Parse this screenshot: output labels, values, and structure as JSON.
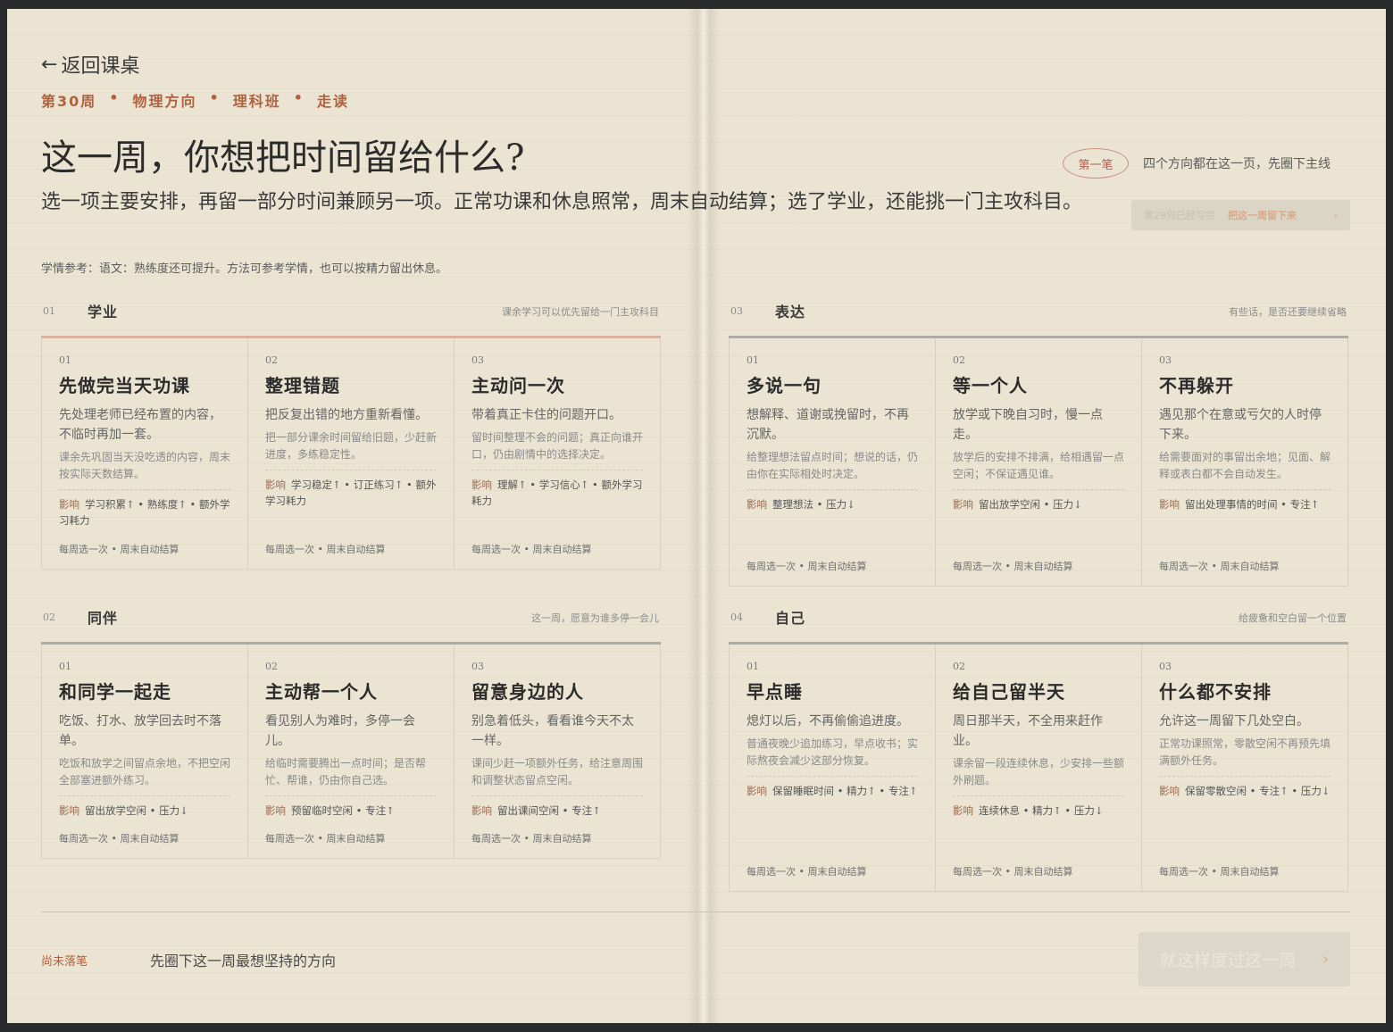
{
  "nav": {
    "back_arrow": "←",
    "back_label": "返回课桌"
  },
  "crumbs": [
    "第30周",
    "物理方向",
    "理科班",
    "走读"
  ],
  "crumb_sep": "•",
  "title": "这一周，你想把时间留给什么?",
  "subtitle": "选一项主要安排，再留一部分时间兼顾另一项。正常功课和休息照常，周末自动结算；选了学业，还能挑一门主攻科目。",
  "hint": "学情参考：语文：熟练度还可提升。方法可参考学情，也可以按精力留出休息。",
  "stamp": {
    "label": "第一笔",
    "note": "四个方向都在这一页，先圈下主线"
  },
  "save_week": {
    "done": "第29周已经写完",
    "action": "把这一周留下来",
    "arrow": "›"
  },
  "sections": [
    {
      "num": "01",
      "title": "学业",
      "note": "课余学习可以优先留给一门主攻科目",
      "cards": [
        {
          "num": "01",
          "title": "先做完当天功课",
          "desc": "先处理老师已经布置的内容，不临时再加一套。",
          "detail": "课余先巩固当天没吃透的内容，周末按实际天数结算。",
          "impact_label": "影响",
          "impact": "学习积累↑ • 熟练度↑ • 额外学习耗力",
          "foot": "每周选一次 • 周末自动结算"
        },
        {
          "num": "02",
          "title": "整理错题",
          "desc": "把反复出错的地方重新看懂。",
          "detail": "把一部分课余时间留给旧题，少赶新进度，多练稳定性。",
          "impact_label": "影响",
          "impact": "学习稳定↑ • 订正练习↑ • 额外学习耗力",
          "foot": "每周选一次 • 周末自动结算"
        },
        {
          "num": "03",
          "title": "主动问一次",
          "desc": "带着真正卡住的问题开口。",
          "detail": "留时间整理不会的问题；真正向谁开口，仍由剧情中的选择决定。",
          "impact_label": "影响",
          "impact": "理解↑ • 学习信心↑ • 额外学习耗力",
          "foot": "每周选一次 • 周末自动结算"
        }
      ]
    },
    {
      "num": "02",
      "title": "同伴",
      "note": "这一周，愿意为谁多停一会儿",
      "cards": [
        {
          "num": "01",
          "title": "和同学一起走",
          "desc": "吃饭、打水、放学回去时不落单。",
          "detail": "吃饭和放学之间留点余地，不把空闲全部塞进额外练习。",
          "impact_label": "影响",
          "impact": "留出放学空闲 • 压力↓",
          "foot": "每周选一次 • 周末自动结算"
        },
        {
          "num": "02",
          "title": "主动帮一个人",
          "desc": "看见别人为难时，多停一会儿。",
          "detail": "给临时需要腾出一点时间；是否帮忙、帮谁，仍由你自己选。",
          "impact_label": "影响",
          "impact": "预留临时空闲 • 专注↑",
          "foot": "每周选一次 • 周末自动结算"
        },
        {
          "num": "03",
          "title": "留意身边的人",
          "desc": "别急着低头，看看谁今天不太一样。",
          "detail": "课间少赶一项额外任务，给注意周围和调整状态留点空闲。",
          "impact_label": "影响",
          "impact": "留出课间空闲 • 专注↑",
          "foot": "每周选一次 • 周末自动结算"
        }
      ]
    },
    {
      "num": "03",
      "title": "表达",
      "note": "有些话，是否还要继续省略",
      "cards": [
        {
          "num": "01",
          "title": "多说一句",
          "desc": "想解释、道谢或挽留时，不再沉默。",
          "detail": "给整理想法留点时间；想说的话，仍由你在实际相处时决定。",
          "impact_label": "影响",
          "impact": "整理想法 • 压力↓",
          "foot": "每周选一次 • 周末自动结算"
        },
        {
          "num": "02",
          "title": "等一个人",
          "desc": "放学或下晚自习时，慢一点走。",
          "detail": "放学后的安排不排满，给相遇留一点空闲；不保证遇见谁。",
          "impact_label": "影响",
          "impact": "留出放学空闲 • 压力↓",
          "foot": "每周选一次 • 周末自动结算"
        },
        {
          "num": "03",
          "title": "不再躲开",
          "desc": "遇见那个在意或亏欠的人时停下来。",
          "detail": "给需要面对的事留出余地；见面、解释或表白都不会自动发生。",
          "impact_label": "影响",
          "impact": "留出处理事情的时间 • 专注↑",
          "foot": "每周选一次 • 周末自动结算"
        }
      ]
    },
    {
      "num": "04",
      "title": "自己",
      "note": "给疲惫和空白留一个位置",
      "cards": [
        {
          "num": "01",
          "title": "早点睡",
          "desc": "熄灯以后，不再偷偷追进度。",
          "detail": "普通夜晚少追加练习，早点收书；实际熬夜会减少这部分恢复。",
          "impact_label": "影响",
          "impact": "保留睡眠时间 • 精力↑ • 专注↑",
          "foot": "每周选一次 • 周末自动结算"
        },
        {
          "num": "02",
          "title": "给自己留半天",
          "desc": "周日那半天，不全用来赶作业。",
          "detail": "课余留一段连续休息，少安排一些额外刷题。",
          "impact_label": "影响",
          "impact": "连续休息 • 精力↑ • 压力↓",
          "foot": "每周选一次 • 周末自动结算"
        },
        {
          "num": "03",
          "title": "什么都不安排",
          "desc": "允许这一周留下几处空白。",
          "detail": "正常功课照常，零散空闲不再预先填满额外任务。",
          "impact_label": "影响",
          "impact": "保留零散空闲 • 专注↑ • 压力↓",
          "foot": "每周选一次 • 周末自动结算"
        }
      ]
    }
  ],
  "footer": {
    "status": "尚未落笔",
    "text": "先圈下这一周最想坚持的方向",
    "submit": "就这样度过这一周",
    "submit_arrow": "›"
  }
}
